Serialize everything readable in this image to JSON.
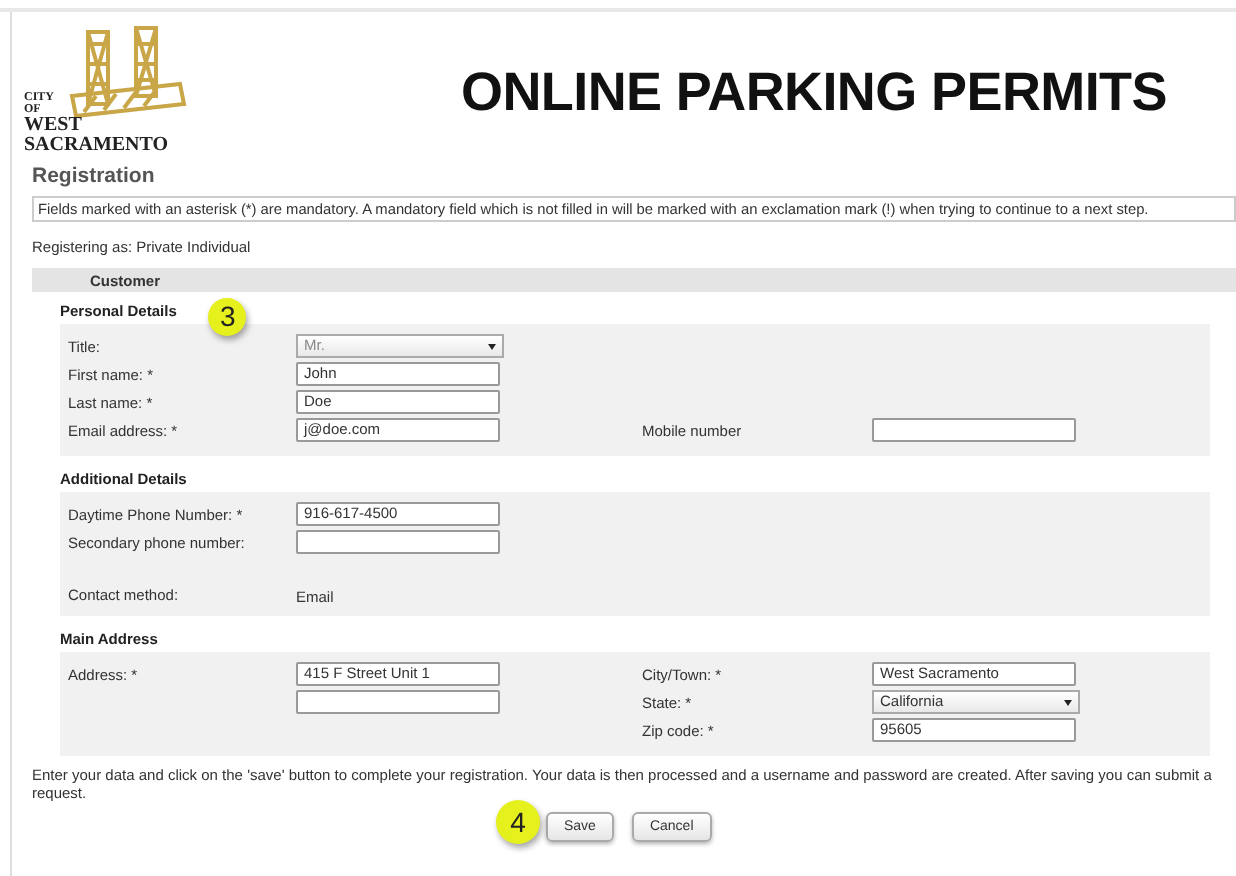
{
  "header": {
    "logo_lines": [
      "CITY",
      "OF",
      "WEST",
      "SACRAMENTO"
    ],
    "title": "ONLINE PARKING PERMITS"
  },
  "page_title": "Registration",
  "notice": "Fields marked with an asterisk (*) are mandatory. A mandatory field which is not filled in will be marked with an exclamation mark (!) when trying to continue to a next step.",
  "registering_as": "Registering as: Private Individual",
  "section_header": "Customer",
  "panels": [
    {
      "heading": "Personal Details",
      "badge": "3",
      "rows": [
        {
          "left": {
            "label": "Title:",
            "kind": "select",
            "value": "Mr.",
            "disabled": true
          }
        },
        {
          "left": {
            "label": "First name: *",
            "kind": "input",
            "value": "John"
          }
        },
        {
          "left": {
            "label": "Last name: *",
            "kind": "input",
            "value": "Doe"
          }
        },
        {
          "left": {
            "label": "Email address: *",
            "kind": "input",
            "value": "j@doe.com"
          },
          "right": {
            "label": "Mobile number",
            "kind": "input"
          }
        }
      ]
    },
    {
      "heading": "Additional Details",
      "rows": [
        {
          "left": {
            "label": "Daytime Phone Number: *",
            "kind": "input",
            "value": "916-617-4500"
          }
        },
        {
          "left": {
            "label": "Secondary phone number:",
            "kind": "input"
          }
        },
        {
          "left": {
            "label": "Contact method:",
            "kind": "text",
            "value": "Email"
          }
        }
      ]
    },
    {
      "heading": "Main Address",
      "rows": [
        {
          "left": {
            "label": "Address: *",
            "kind": "input",
            "value": "415 F Street Unit 1"
          },
          "right": {
            "label": "City/Town: *",
            "kind": "input",
            "value": "West Sacramento"
          }
        },
        {
          "left": {
            "kind": "input"
          },
          "right": {
            "label": "State: *",
            "kind": "select",
            "value": "California",
            "disabled": false
          }
        },
        {
          "right": {
            "label": "Zip code: *",
            "kind": "input",
            "value": "95605"
          }
        }
      ]
    }
  ],
  "footer_text": "Enter your data and click on the 'save' button to complete your registration. Your data is then processed and a username and password are created. After saving you can submit a request.",
  "step_badge": "4",
  "buttons": [
    "Save",
    "Cancel"
  ]
}
